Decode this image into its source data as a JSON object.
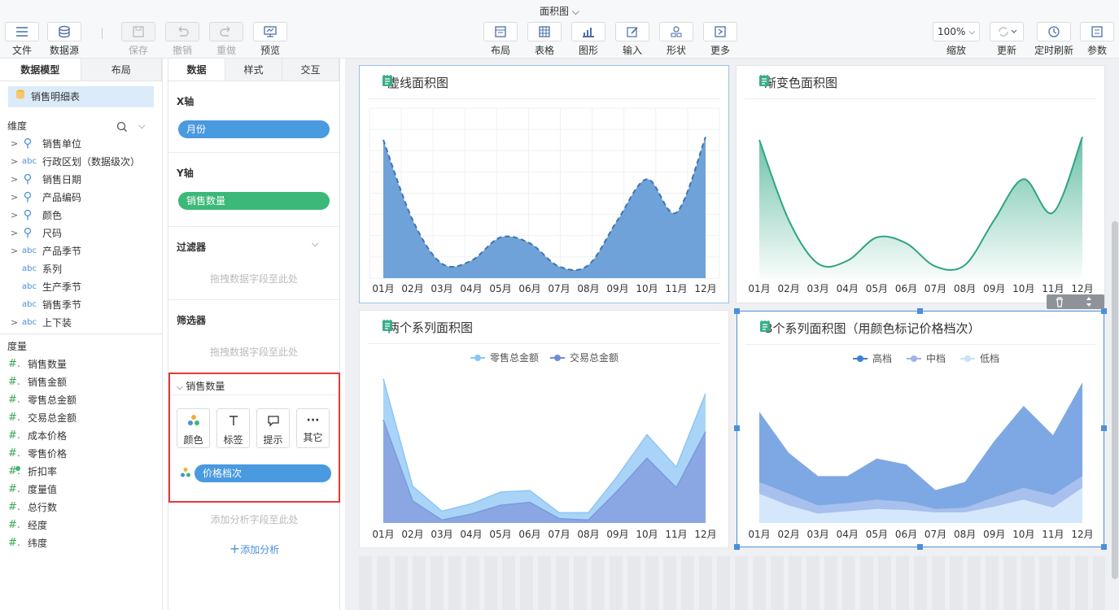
{
  "window": {
    "title": "面积图 ⌵"
  },
  "toolbar": {
    "file": "文件",
    "datasource": "数据源",
    "save": "保存",
    "undo": "撤销",
    "redo": "重做",
    "preview": "预览",
    "layout": "布局",
    "table": "表格",
    "graphic": "图形",
    "input": "输入",
    "shape": "形状",
    "more": "更多",
    "zoom_value": "100%",
    "zoom": "缩放",
    "refresh": "更新",
    "timed_refresh": "定时刷新",
    "params": "参数"
  },
  "left": {
    "tabs": [
      "数据模型",
      "布局"
    ],
    "dataset": "销售明细表",
    "dim_title": "维度",
    "dimensions": [
      {
        "label": "销售单位",
        "type": "geo",
        "arrow": true
      },
      {
        "label": "行政区划（数据级次）",
        "type": "abc",
        "arrow": true
      },
      {
        "label": "销售日期",
        "type": "geo",
        "arrow": true
      },
      {
        "label": "产品编码",
        "type": "geo",
        "arrow": true
      },
      {
        "label": "颜色",
        "type": "geo",
        "arrow": true
      },
      {
        "label": "尺码",
        "type": "geo",
        "arrow": true
      },
      {
        "label": "产品季节",
        "type": "abc",
        "arrow": true
      },
      {
        "label": "系列",
        "type": "abc",
        "arrow": false
      },
      {
        "label": "生产季节",
        "type": "abc",
        "arrow": false
      },
      {
        "label": "销售季节",
        "type": "abc",
        "arrow": false
      },
      {
        "label": "上下装",
        "type": "abc",
        "arrow": true
      }
    ],
    "measure_title": "度量",
    "measures": [
      "销售数量",
      "销售金额",
      "零售总金额",
      "交易总金额",
      "成本价格",
      "零售价格",
      "折扣率",
      "度量值",
      "总行数",
      "经度",
      "纬度"
    ]
  },
  "mid": {
    "tabs": [
      "数据",
      "样式",
      "交互"
    ],
    "x_axis": "X轴",
    "x_field": "月份",
    "y_axis": "Y轴",
    "y_field": "销售数量",
    "filter": "过滤器",
    "filter_hint": "拖拽数据字段至此处",
    "selector": "筛选器",
    "selector_hint": "拖拽数据字段至此处",
    "measure_box": "销售数量",
    "marks": [
      "颜色",
      "标签",
      "提示",
      "其它"
    ],
    "color_field": "价格档次",
    "analysis_hint": "添加分析字段至此处",
    "add_analysis": "添加分析"
  },
  "cards": [
    {
      "title": "虚线面积图"
    },
    {
      "title": "渐变色面积图"
    },
    {
      "title": "两个系列面积图"
    },
    {
      "title": "3个系列面积图（用颜色标记价格档次）"
    }
  ],
  "card_toolbar": {
    "delete_icon": "trash-icon",
    "move_icon": "move-icon"
  },
  "colors": {
    "blue": "#4a8fd8",
    "green": "#3cb878",
    "accent_red": "#e53935",
    "area_blue": "#6fa2d8",
    "teal": "#3aad8b"
  },
  "chart_data": [
    {
      "type": "area",
      "categories": [
        "01月",
        "02月",
        "03月",
        "04月",
        "05月",
        "06月",
        "07月",
        "08月",
        "09月",
        "10月",
        "11月",
        "12月"
      ],
      "series": [
        {
          "values": [
            95,
            40,
            10,
            12,
            28,
            24,
            8,
            9,
            40,
            68,
            45,
            97
          ]
        }
      ],
      "ylim": [
        0,
        100
      ],
      "grid": true,
      "line_style": "dashed"
    },
    {
      "type": "area",
      "categories": [
        "01月",
        "02月",
        "03月",
        "04月",
        "05月",
        "06月",
        "07月",
        "08月",
        "09月",
        "10月",
        "11月",
        "12月"
      ],
      "series": [
        {
          "values": [
            95,
            40,
            10,
            12,
            28,
            24,
            8,
            9,
            40,
            68,
            45,
            97
          ]
        }
      ],
      "ylim": [
        0,
        100
      ],
      "grid": false,
      "fill": "gradient"
    },
    {
      "type": "area",
      "categories": [
        "01月",
        "02月",
        "03月",
        "04月",
        "05月",
        "06月",
        "07月",
        "08月",
        "09月",
        "10月",
        "11月",
        "12月"
      ],
      "series": [
        {
          "name": "零售总金额",
          "values": [
            98,
            25,
            8,
            13,
            21,
            22,
            7,
            7,
            32,
            60,
            38,
            88
          ]
        },
        {
          "name": "交易总金额",
          "values": [
            70,
            15,
            2,
            6,
            12,
            14,
            3,
            2,
            22,
            44,
            24,
            62
          ]
        }
      ],
      "ylim": [
        0,
        100
      ],
      "legend": "top-center"
    },
    {
      "type": "area",
      "categories": [
        "01月",
        "02月",
        "03月",
        "04月",
        "05月",
        "06月",
        "07月",
        "08月",
        "09月",
        "10月",
        "11月",
        "12月"
      ],
      "series": [
        {
          "name": "高档",
          "values": [
            25,
            15,
            8,
            10,
            12,
            11,
            9,
            9,
            14,
            20,
            13,
            30
          ]
        },
        {
          "name": "中档",
          "values": [
            35,
            25,
            15,
            17,
            20,
            18,
            12,
            13,
            22,
            30,
            24,
            40
          ]
        },
        {
          "name": "低档",
          "values": [
            95,
            60,
            40,
            40,
            55,
            50,
            28,
            35,
            70,
            100,
            75,
            120
          ]
        }
      ],
      "ylim": [
        0,
        125
      ],
      "legend": "top-center"
    }
  ]
}
